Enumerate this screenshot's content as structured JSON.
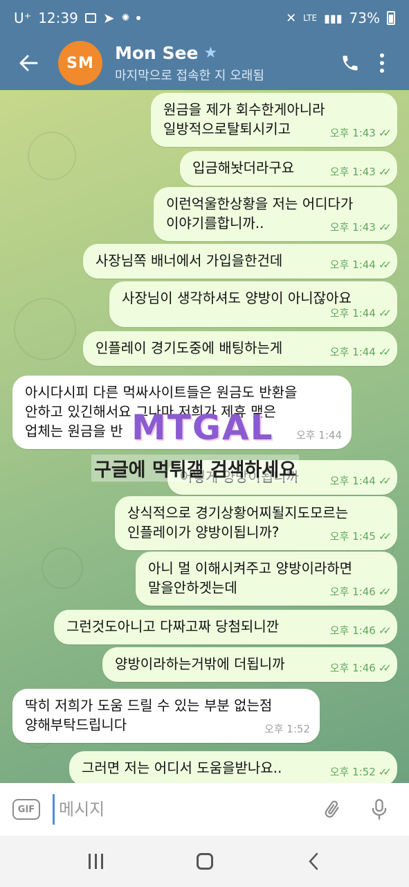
{
  "status_bar": {
    "carrier": "U⁺",
    "time": "12:39",
    "network": "LTE",
    "battery": "73%"
  },
  "header": {
    "avatar_initials": "SM",
    "name": "Mon See",
    "star_icon": "★",
    "subtitle": "마지막으로 접속한 지 오래됨"
  },
  "messages": [
    {
      "text": "원금을 제가 회수한게아니라\n일방적으로탈퇴시키고",
      "time": "오후 1:43",
      "dir": "out"
    },
    {
      "text": "입금해놧더라구요",
      "time": "오후 1:43",
      "dir": "out"
    },
    {
      "text": "이런억울한상황을 저는 어디다가\n이야기를합니까..",
      "time": "오후 1:43",
      "dir": "out"
    },
    {
      "text": "사장님쪽 배너에서 가입을한건데",
      "time": "오후 1:44",
      "dir": "out"
    },
    {
      "text": "사장님이 생각하셔도 양방이 아니잖아요",
      "time": "오후 1:44",
      "dir": "out"
    },
    {
      "text": "인플레이 경기도중에 배팅하는게",
      "time": "오후 1:44",
      "dir": "out"
    },
    {
      "text": "아시다시피 다른 먹싸사이트들은 원금도 반환을\n안하고 있긴해서요 그나마 저희가 제휴 맺은\n업체는 원금을 반",
      "time": "오후 1:44",
      "dir": "in"
    },
    {
      "text": "어떻게 양방이됩니까",
      "time": "오후 1:44",
      "dir": "out"
    },
    {
      "text": "상식적으로 경기상황어찌될지도모르는\n인플레이가 양방이됩니까?",
      "time": "오후 1:45",
      "dir": "out"
    },
    {
      "text": "아니 멀 이해시켜주고 양방이라하면\n말을안하겟는데",
      "time": "오후 1:46",
      "dir": "out"
    },
    {
      "text": "그런것도아니고 다짜고짜 당첨되니깐",
      "time": "오후 1:46",
      "dir": "out"
    },
    {
      "text": "양방이라하는거밖에 더됩니까",
      "time": "오후 1:46",
      "dir": "out"
    },
    {
      "text": "딱히 저희가 도움 드릴 수 있는 부분 없는점\n양해부탁드립니다",
      "time": "오후 1:52",
      "dir": "in"
    },
    {
      "text": "그러면 저는 어디서 도움을받나요..",
      "time": "오후 1:52",
      "dir": "out"
    }
  ],
  "watermark": {
    "logo": "MTGAL",
    "text": "구글에 먹튀갤 검색하세요"
  },
  "input": {
    "gif_label": "GIF",
    "placeholder": "메시지"
  },
  "icons": {
    "back": "arrow-left-icon",
    "call": "phone-icon",
    "menu": "more-vert-icon",
    "attach": "paperclip-icon",
    "mic": "microphone-icon",
    "read": "double-check-icon"
  }
}
